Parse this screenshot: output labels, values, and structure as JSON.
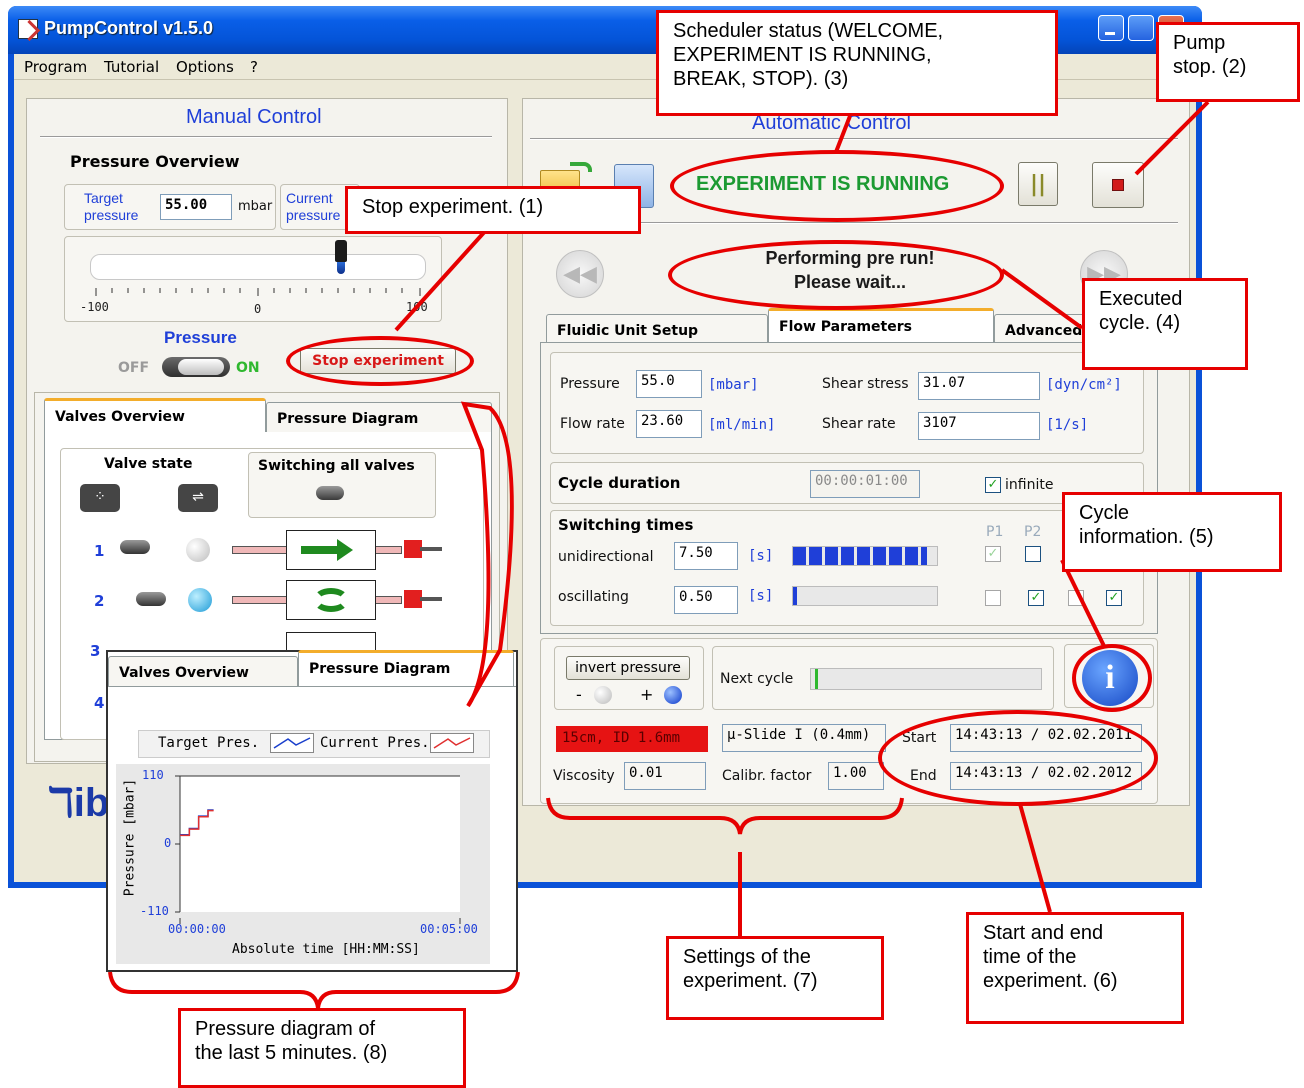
{
  "window": {
    "title": "PumpControl v1.5.0",
    "menu": [
      "Program",
      "Tutorial",
      "Options",
      "?"
    ]
  },
  "manual": {
    "title": "Manual Control",
    "pressure_overview": "Pressure Overview",
    "target_label": "Target\npressure",
    "target_value": "55.00",
    "target_unit": "mbar",
    "current_label": "Current\npressure",
    "scale_min": "-100",
    "scale_mid": "0",
    "scale_max": "100",
    "slider_level": 0.76,
    "pressure_label": "Pressure",
    "off": "OFF",
    "on": "ON",
    "stop_button": "Stop experiment",
    "tabs": [
      "Valves Overview",
      "Pressure Diagram"
    ],
    "valve_state": "Valve state",
    "switching_all": "Switching all valves",
    "valves": [
      "1",
      "2",
      "3",
      "4"
    ]
  },
  "auto": {
    "title": "Automatic Control",
    "status": "EXPERIMENT IS RUNNING",
    "performing_line1": "Performing pre run!",
    "performing_line2": "Please wait...",
    "tabs": [
      "Fluidic Unit Setup",
      "Flow Parameters",
      "Advanced"
    ],
    "pressure_label": "Pressure",
    "pressure_value": "55.0",
    "pressure_unit": "[mbar]",
    "flow_label": "Flow rate",
    "flow_value": "23.60",
    "flow_unit": "[ml/min]",
    "shear_stress_label": "Shear stress",
    "shear_stress_value": "31.07",
    "shear_stress_unit": "[dyn/cm²]",
    "shear_rate_label": "Shear rate",
    "shear_rate_value": "3107",
    "shear_rate_unit": "[1/s]",
    "cycle_duration_label": "Cycle duration",
    "cycle_duration_value": "00:00:01:00",
    "infinite_label": "infinite",
    "switching_times": "Switching times",
    "p1": "P1",
    "p2": "P2",
    "uni_label": "unidirectional",
    "uni_value": "7.50",
    "uni_unit": "[s]",
    "uni_level": 0.93,
    "osc_label": "oscillating",
    "osc_value": "0.50",
    "osc_unit": "[s]",
    "osc_level": 0.03,
    "invert_pressure": "invert pressure",
    "minus": "-",
    "plus": "+",
    "next_cycle": "Next cycle",
    "tubing": "15cm, ID 1.6mm",
    "slide": "µ-Slide I (0.4mm)",
    "viscosity_label": "Viscosity",
    "viscosity_value": "0.01",
    "calibr_label": "Calibr. factor",
    "calibr_value": "1.00",
    "start_label": "Start",
    "start_value": "14:43:13 / 02.02.2011",
    "end_label": "End",
    "end_value": "14:43:13 / 02.02.2012"
  },
  "callouts": {
    "c1": "Stop experiment. (1)",
    "c2": "Pump\nstop. (2)",
    "c3": "Scheduler status (WELCOME,\nEXPERIMENT IS RUNNING,\nBREAK, STOP). (3)",
    "c4": "Executed\ncycle. (4)",
    "c5": "Cycle\ninformation. (5)",
    "c6": "Start and end\ntime of the\nexperiment. (6)",
    "c7": "Settings of the\nexperiment. (7)",
    "c8": "Pressure diagram of\nthe last 5 minutes. (8)"
  },
  "inset": {
    "tabs": [
      "Valves Overview",
      "Pressure Diagram"
    ],
    "legend_target": "Target Pres.",
    "legend_current": "Current Pres.",
    "ylabel": "Pressure [mbar]",
    "xlabel": "Absolute time [HH:MM:SS]",
    "y_ticks": [
      "110",
      "0",
      "-110"
    ],
    "x_ticks": [
      "00:00:00",
      "00:05:00"
    ]
  },
  "chart_data": {
    "type": "line",
    "xlabel": "Absolute time [HH:MM:SS]",
    "ylabel": "Pressure [mbar]",
    "ylim": [
      -110,
      110
    ],
    "xlim": [
      "00:00:00",
      "00:05:00"
    ],
    "series": [
      {
        "name": "Target Pres.",
        "x_seconds": [
          0,
          10,
          10,
          20,
          20,
          30,
          30,
          36
        ],
        "values": [
          15,
          15,
          25,
          25,
          45,
          45,
          55,
          55
        ]
      },
      {
        "name": "Current Pres.",
        "x_seconds": [
          0,
          10,
          10,
          20,
          20,
          30,
          30,
          36
        ],
        "values": [
          14,
          14,
          24,
          24,
          44,
          44,
          54,
          54
        ]
      }
    ],
    "colors": {
      "target": "#1a3fcc",
      "current": "#e03030"
    }
  }
}
